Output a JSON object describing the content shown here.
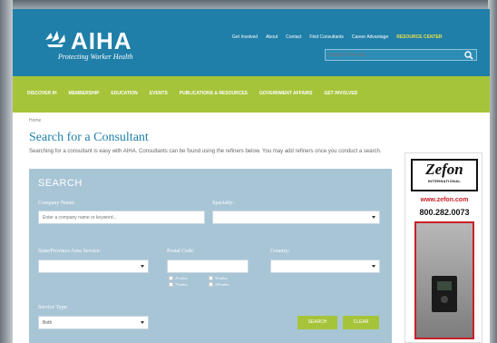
{
  "header": {
    "logo_text": "AIHA",
    "tagline": "Protecting Worker Health",
    "top_links": [
      "Get Involved",
      "About",
      "Contact",
      "Find Consultants",
      "Career Advantage",
      "RESOURCE CENTER"
    ],
    "search_placeholder": "Search the site..."
  },
  "nav": {
    "items": [
      "DISCOVER IH",
      "MEMBERSHIP",
      "EDUCATION",
      "EVENTS",
      "PUBLICATIONS & RESOURCES",
      "GOVERNMENT AFFAIRS",
      "GET INVOLVED"
    ]
  },
  "breadcrumb": "Home",
  "page": {
    "title": "Search for a Consultant",
    "intro": "Searching for a consultant is easy with AIHA. Consultants can be found using the refiners below. You may add refiners once you conduct a search."
  },
  "search": {
    "heading": "SEARCH",
    "company_label": "Company Name:",
    "company_placeholder": "Enter a company name or keyword...",
    "specialty_label": "Specialty:",
    "specialty_value": "",
    "state_label": "State/Province Area Service:",
    "state_value": "",
    "postal_label": "Postal Code:",
    "postal_value": "",
    "country_label": "Country:",
    "country_value": "",
    "radius_options": [
      "25 miles",
      "50 miles",
      "75 miles",
      "100 miles"
    ],
    "service_type_label": "Service Type:",
    "service_type_value": "Both",
    "search_button": "SEARCH",
    "clear_button": "CLEAR"
  },
  "ad": {
    "brand": "Zefon",
    "brand_sub": "INTERNATIONAL",
    "url": "www.zefon.com",
    "phone": "800.282.0073"
  },
  "colors": {
    "header_blue": "#1f7fa8",
    "nav_green": "#a6c43a",
    "panel_blue": "#a8c5d6",
    "ad_red": "#c8202a"
  }
}
